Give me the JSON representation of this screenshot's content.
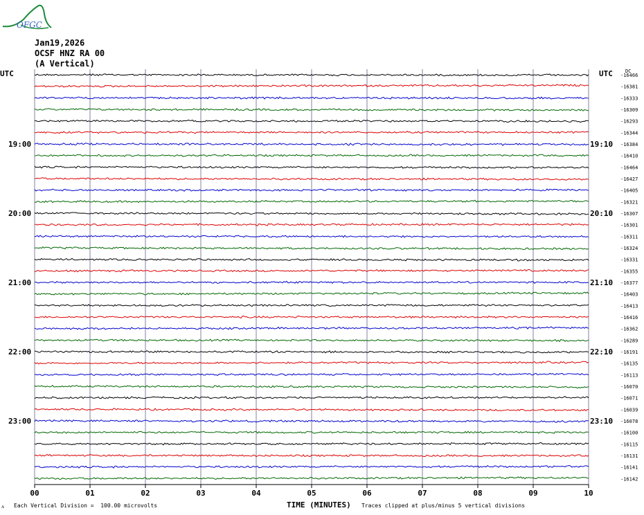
{
  "logo": {
    "text": "OFGC",
    "icon": "ofgc-logo-icon",
    "color": "#1a8a3a",
    "text_color": "#3060c0"
  },
  "header": {
    "date": "Jan19,2026",
    "station": "OCSF HNZ RA 00",
    "component": "(A Vertical)"
  },
  "footer": {
    "left_mark": "ᴧ",
    "scale_note": "Each Vertical Division =  100.00 microvolts",
    "xaxis_title": "TIME (MINUTES)",
    "clip_note": "Traces clipped at plus/minus 5 vertical divisions"
  },
  "chart_data": {
    "type": "line",
    "title": "",
    "xlabel": "TIME (MINUTES)",
    "x_ticks": [
      "00",
      "01",
      "02",
      "03",
      "04",
      "05",
      "06",
      "07",
      "08",
      "09",
      "10"
    ],
    "xlim": [
      0,
      10
    ],
    "left_axis_label": "UTC",
    "right_axis_label": "UTC",
    "right_header": "DC",
    "left_time_labels": [
      "19:00",
      "20:00",
      "21:00",
      "22:00",
      "23:00"
    ],
    "right_time_labels": [
      "19:10",
      "20:10",
      "21:10",
      "22:10",
      "23:10"
    ],
    "hour_label_rows": [
      6,
      12,
      18,
      24,
      30
    ],
    "trace_colors": [
      "#000000",
      "#dd0000",
      "#0000cc",
      "#006600"
    ],
    "grid": true,
    "traces": [
      {
        "row": 0,
        "dc": "-16466"
      },
      {
        "row": 1,
        "dc": "-16381"
      },
      {
        "row": 2,
        "dc": "-16333"
      },
      {
        "row": 3,
        "dc": "-16309"
      },
      {
        "row": 4,
        "dc": "-16293"
      },
      {
        "row": 5,
        "dc": "-16344"
      },
      {
        "row": 6,
        "dc": "-16384"
      },
      {
        "row": 7,
        "dc": "-16410"
      },
      {
        "row": 8,
        "dc": "-16464"
      },
      {
        "row": 9,
        "dc": "-16427"
      },
      {
        "row": 10,
        "dc": "-16405"
      },
      {
        "row": 11,
        "dc": "-16321"
      },
      {
        "row": 12,
        "dc": "-16307"
      },
      {
        "row": 13,
        "dc": "-16301"
      },
      {
        "row": 14,
        "dc": "-16311"
      },
      {
        "row": 15,
        "dc": "-16324"
      },
      {
        "row": 16,
        "dc": "-16331"
      },
      {
        "row": 17,
        "dc": "-16355"
      },
      {
        "row": 18,
        "dc": "-16377"
      },
      {
        "row": 19,
        "dc": "-16403"
      },
      {
        "row": 20,
        "dc": "-16413"
      },
      {
        "row": 21,
        "dc": "-16416"
      },
      {
        "row": 22,
        "dc": "-16362"
      },
      {
        "row": 23,
        "dc": "-16289"
      },
      {
        "row": 24,
        "dc": "-16191"
      },
      {
        "row": 25,
        "dc": "-16135"
      },
      {
        "row": 26,
        "dc": "-16113"
      },
      {
        "row": 27,
        "dc": "-16070"
      },
      {
        "row": 28,
        "dc": "-16071"
      },
      {
        "row": 29,
        "dc": "-16039"
      },
      {
        "row": 30,
        "dc": "-16078"
      },
      {
        "row": 31,
        "dc": "-16100"
      },
      {
        "row": 32,
        "dc": "-16115"
      },
      {
        "row": 33,
        "dc": "-16131"
      },
      {
        "row": 34,
        "dc": "-16141"
      },
      {
        "row": 35,
        "dc": "-16142"
      }
    ]
  }
}
